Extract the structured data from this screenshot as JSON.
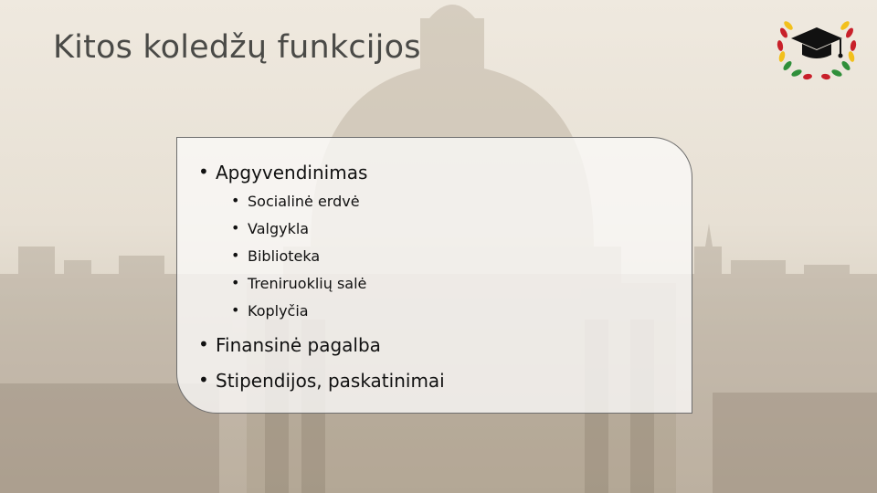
{
  "slide": {
    "title": "Kitos koledžų funkcijos",
    "items": [
      {
        "label": "Apgyvendinimas",
        "level": 1
      },
      {
        "label": "Socialinė erdvė",
        "level": 2
      },
      {
        "label": "Valgykla",
        "level": 2
      },
      {
        "label": "Biblioteka",
        "level": 2
      },
      {
        "label": "Treniruoklių salė",
        "level": 2
      },
      {
        "label": "Koplyčia",
        "level": 2
      },
      {
        "label": "Finansinė pagalba",
        "level": 1
      },
      {
        "label": "Stipendijos, paskatinimai",
        "level": 1
      }
    ]
  },
  "icons": {
    "logo": "graduation-cap-laurel-logo"
  },
  "colors": {
    "title": "#4a4a47",
    "text": "#111111",
    "panel_border": "#6e6e6e",
    "laurel_red": "#c8202a",
    "laurel_yellow": "#f2c01c",
    "laurel_green": "#2f8f3a"
  }
}
